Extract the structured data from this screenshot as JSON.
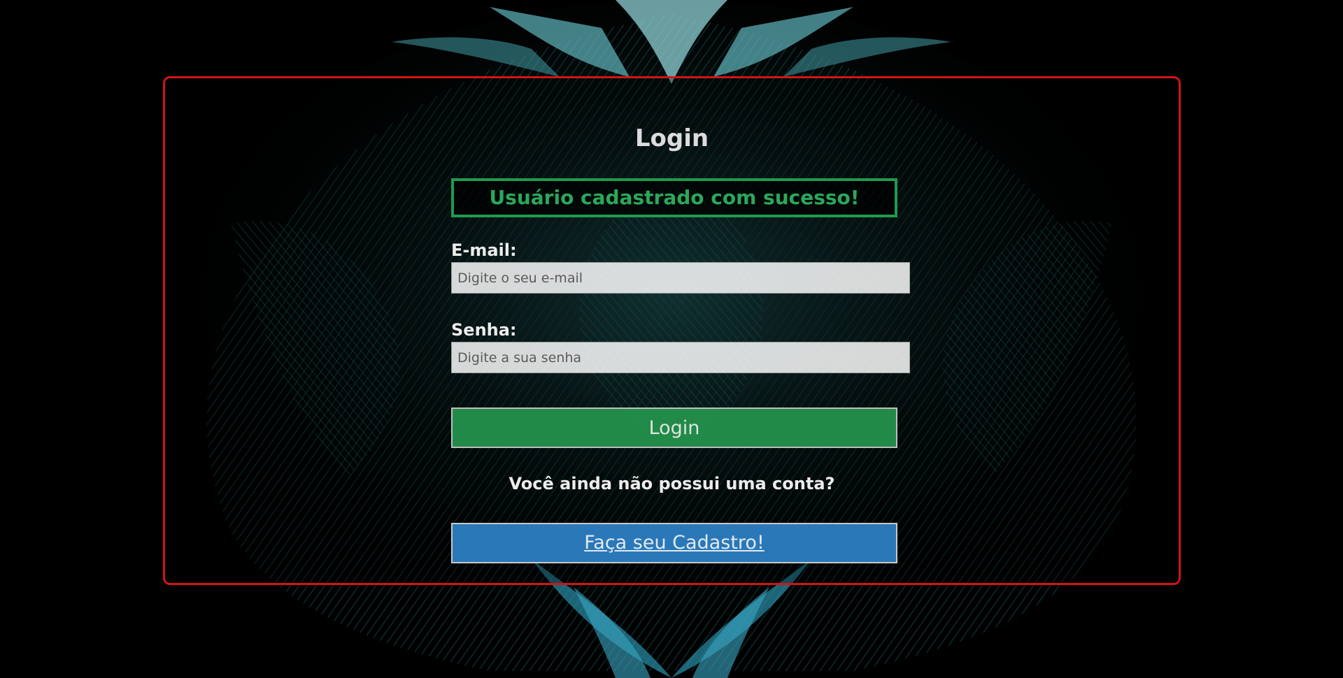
{
  "login": {
    "title": "Login",
    "success_message": "Usuário cadastrado com sucesso!",
    "email_label": "E-mail:",
    "email_placeholder": "Digite o seu e-mail",
    "email_value": "",
    "password_label": "Senha:",
    "password_placeholder": "Digite a sua senha",
    "password_value": "",
    "login_button": "Login",
    "no_account_text": "Você ainda não possui uma conta?",
    "register_link": "Faça seu Cadastro!"
  },
  "colors": {
    "panel_border": "#d01515",
    "success": "#2aa85a",
    "login_button": "#24914c",
    "register_button": "#2b78b8",
    "background": "#000000"
  },
  "background": {
    "image_description_icon": "lion-illustration"
  }
}
